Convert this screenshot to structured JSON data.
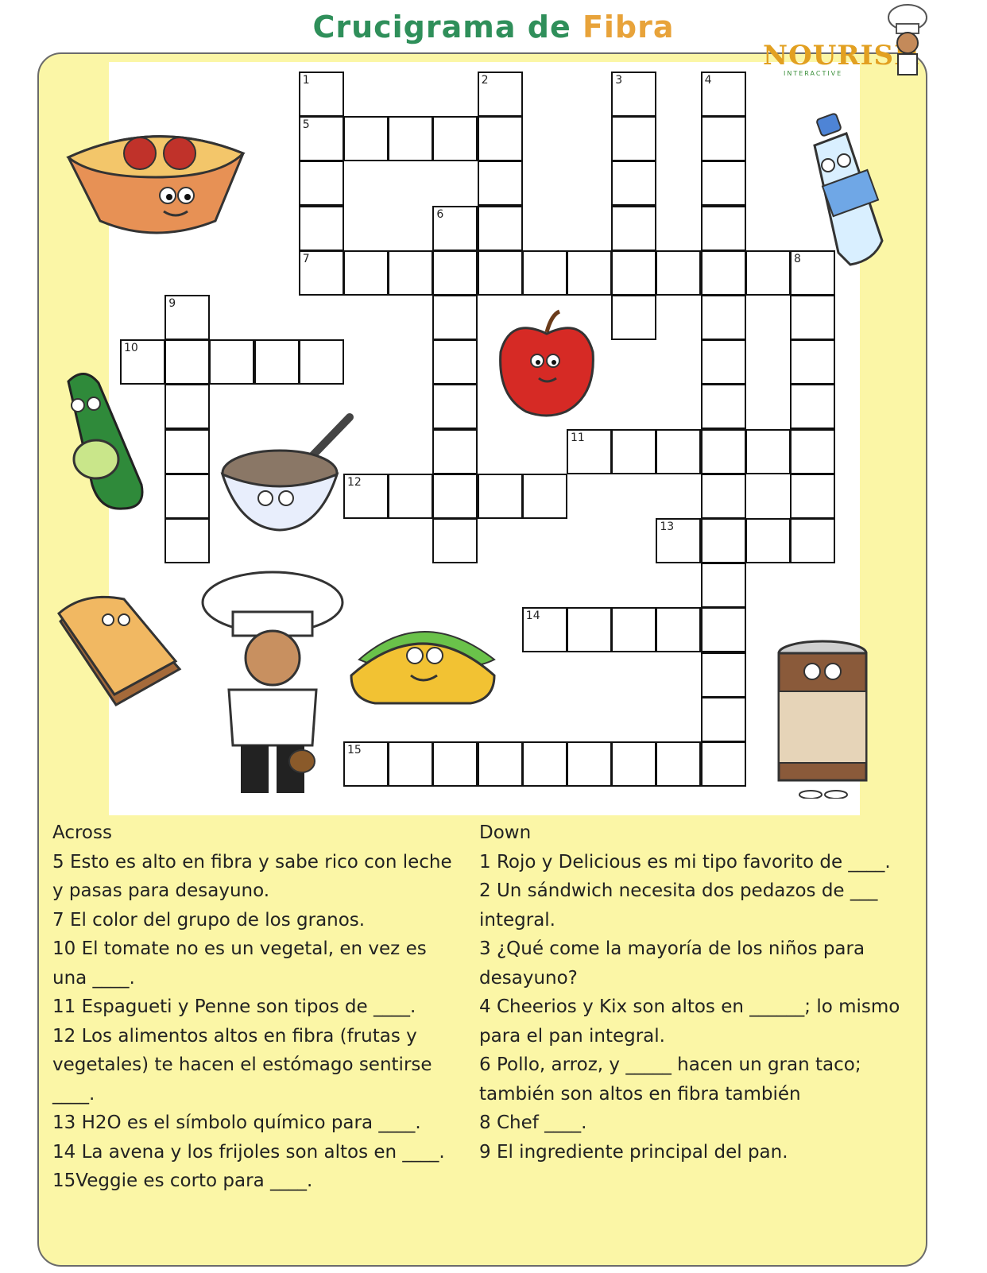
{
  "header": {
    "title_part1": "Crucigrama de ",
    "title_part2": "Fibra",
    "logo_text": "NOURISH",
    "logo_subtext": "INTERACTIVE"
  },
  "puzzle": {
    "numbers": [
      "1",
      "2",
      "3",
      "4",
      "5",
      "6",
      "7",
      "8",
      "9",
      "10",
      "11",
      "12",
      "13",
      "14",
      "15"
    ]
  },
  "illustrations": [
    "spaghetti-bowl-icon",
    "water-bottle-icon",
    "apple-icon",
    "cucumber-icon",
    "oatmeal-bowl-icon",
    "sandwich-icon",
    "chef-icon",
    "taco-icon",
    "bean-can-icon"
  ],
  "across": {
    "heading": "Across",
    "clues": [
      "5   Esto es alto en fibra y sabe rico con leche y pasas para desayuno.",
      "7   El color del grupo de los granos.",
      "10  El tomate no es un vegetal, en vez es una ____.",
      "11  Espagueti y Penne son tipos de ____.",
      "12  Los alimentos altos en fibra (frutas y vegetales) te hacen el estómago sentirse ____.",
      "13   H2O es el símbolo químico para ____.",
      "14   La avena y los frijoles son altos en ____.",
      "15Veggie es corto para ____."
    ]
  },
  "down": {
    "heading": "Down",
    "clues": [
      "1    Rojo y Delicious es mi tipo favorito de ____.",
      "2  Un sándwich necesita dos pedazos de ___ integral.",
      "3  ¿Qué come la mayoría de los niños para desayuno?",
      "4   Cheerios y Kix son altos en ______; lo mismo para el pan integral.",
      "6   Pollo, arroz, y _____ hacen un gran taco; también son altos en fibra también",
      "8   Chef ____.",
      "9  El ingrediente principal del pan."
    ]
  }
}
